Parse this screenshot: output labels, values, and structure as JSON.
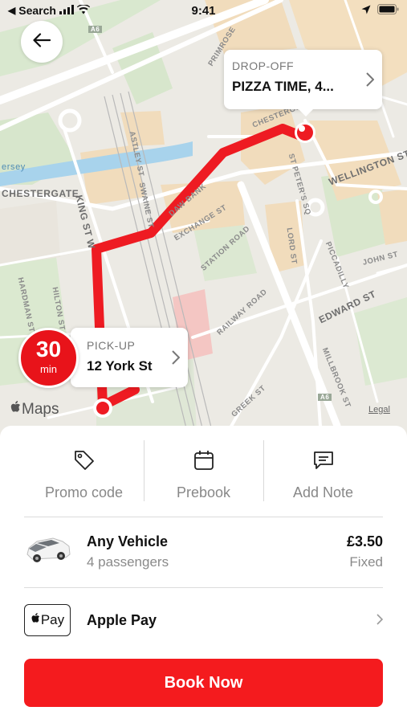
{
  "status_bar": {
    "carrier": "Search",
    "time": "9:41"
  },
  "map": {
    "streets": {
      "primrose": "PRIMROSE",
      "astley": "ASTLEY ST",
      "swaine": "SWAINE ST",
      "chestergate_left": "CHESTERGATE",
      "chestergate_right": "CHESTERGATE",
      "king": "KING ST W",
      "daw_bank": "DAW BANK",
      "exchange": "EXCHANGE ST",
      "station": "STATION ROAD",
      "st_peters": "ST PETER'S SQ",
      "wellington": "WELLINGTON ST",
      "lord": "LORD ST",
      "piccadilly": "PICCADILLY",
      "john": "JOHN ST",
      "edward": "EDWARD ST",
      "railway": "RAILWAY ROAD",
      "millbrook": "MILLBROOK ST",
      "greek": "GREEK ST",
      "hardman": "HARDMAN ST",
      "hilton": "HILTON ST",
      "mersey": "ersey",
      "a6": "A6",
      "a6b": "A6"
    },
    "dropoff": {
      "label": "DROP-OFF",
      "value": "PIZZA TIME, 4..."
    },
    "pickup": {
      "label": "PICK-UP",
      "value": "12 York St"
    },
    "eta": {
      "value": "30",
      "unit": "min"
    },
    "maps_logo": "Maps",
    "legal": "Legal"
  },
  "actions": [
    {
      "label": "Promo code",
      "icon": "tag-icon"
    },
    {
      "label": "Prebook",
      "icon": "calendar-icon"
    },
    {
      "label": "Add Note",
      "icon": "note-icon"
    }
  ],
  "vehicle": {
    "name": "Any Vehicle",
    "passengers": "4 passengers",
    "price": "£3.50",
    "price_type": "Fixed"
  },
  "payment": {
    "badge_text": "Pay",
    "label": "Apple Pay"
  },
  "book_button": "Book Now",
  "colors": {
    "accent": "#f41b1e",
    "route": "#ee1b22",
    "map_bg": "#eceae4"
  }
}
